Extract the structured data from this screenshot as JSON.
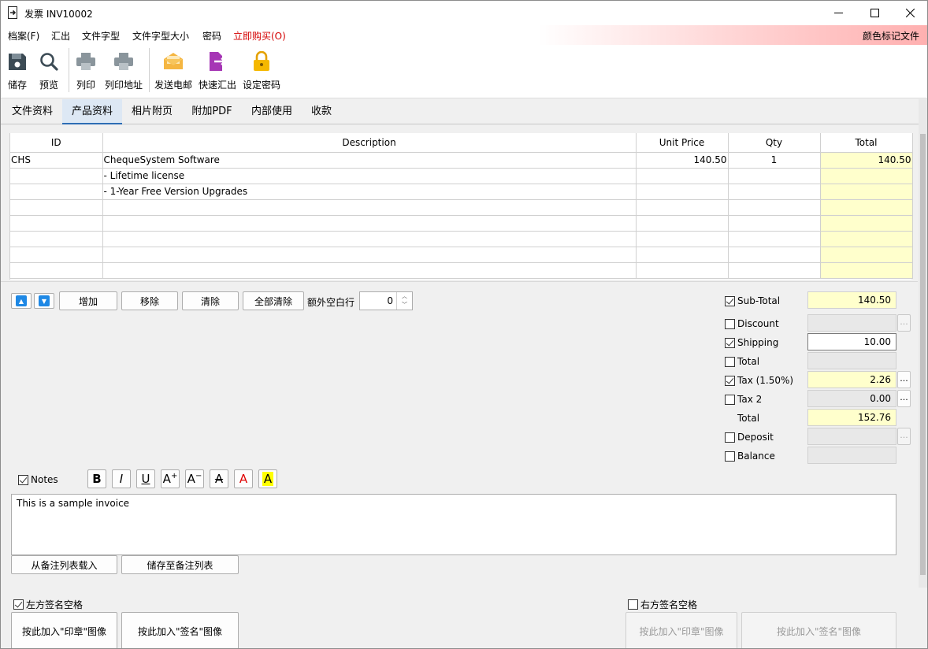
{
  "window": {
    "title": "发票 INV10002"
  },
  "menu": {
    "items": [
      "档案(F)",
      "汇出",
      "文件字型",
      "文件字型大小",
      "密码"
    ],
    "buy": "立即购买(O)",
    "color_tag": "颜色标记文件"
  },
  "toolbar": {
    "save": "储存",
    "preview": "预览",
    "print": "列印",
    "print_address": "列印地址",
    "email": "发送电邮",
    "quick_export": "快速汇出",
    "set_password": "设定密码"
  },
  "tabs": [
    "文件资料",
    "产品资料",
    "相片附页",
    "附加PDF",
    "内部使用",
    "收款"
  ],
  "grid": {
    "headers": {
      "id": "ID",
      "description": "Description",
      "unit_price": "Unit Price",
      "qty": "Qty",
      "total": "Total"
    },
    "rows": [
      {
        "id": "CHS",
        "description": "ChequeSystem Software",
        "unit_price": "140.50",
        "qty": "1",
        "total": "140.50"
      },
      {
        "id": "",
        "description": "- Lifetime license",
        "unit_price": "",
        "qty": "",
        "total": ""
      },
      {
        "id": "",
        "description": "- 1-Year Free Version Upgrades",
        "unit_price": "",
        "qty": "",
        "total": ""
      },
      {
        "id": "",
        "description": "",
        "unit_price": "",
        "qty": "",
        "total": ""
      },
      {
        "id": "",
        "description": "",
        "unit_price": "",
        "qty": "",
        "total": ""
      },
      {
        "id": "",
        "description": "",
        "unit_price": "",
        "qty": "",
        "total": ""
      },
      {
        "id": "",
        "description": "",
        "unit_price": "",
        "qty": "",
        "total": ""
      },
      {
        "id": "",
        "description": "",
        "unit_price": "",
        "qty": "",
        "total": ""
      }
    ]
  },
  "row_actions": {
    "add": "增加",
    "remove": "移除",
    "clear": "清除",
    "clear_all": "全部清除",
    "extra_rows_label": "额外空白行",
    "extra_rows_value": "0"
  },
  "summary": {
    "subtotal": {
      "label": "Sub-Total",
      "value": "140.50",
      "checked": true
    },
    "discount": {
      "label": "Discount",
      "value": "",
      "checked": false
    },
    "shipping": {
      "label": "Shipping",
      "value": "10.00",
      "checked": true
    },
    "total1": {
      "label": "Total",
      "value": "",
      "checked": false
    },
    "tax": {
      "label": "Tax (1.50%)",
      "value": "2.26",
      "checked": true
    },
    "tax2": {
      "label": "Tax 2",
      "value": "0.00",
      "checked": false
    },
    "total": {
      "label": "Total",
      "value": "152.76"
    },
    "deposit": {
      "label": "Deposit",
      "value": "",
      "checked": false
    },
    "balance": {
      "label": "Balance",
      "value": "",
      "checked": false
    },
    "more": "..."
  },
  "notes": {
    "label": "Notes",
    "text": "This is a sample invoice",
    "load_from_list": "从备注列表载入",
    "save_to_list": "储存至备注列表"
  },
  "signature": {
    "left_label": "左方签名空格",
    "right_label": "右方签名空格",
    "add_stamp": "按此加入\"印章\"图像",
    "add_signature": "按此加入\"签名\"图像"
  },
  "colors": {
    "accent": "#2d6db5",
    "yellow_cell": "#ffffcc",
    "buy_red": "#d40000"
  }
}
